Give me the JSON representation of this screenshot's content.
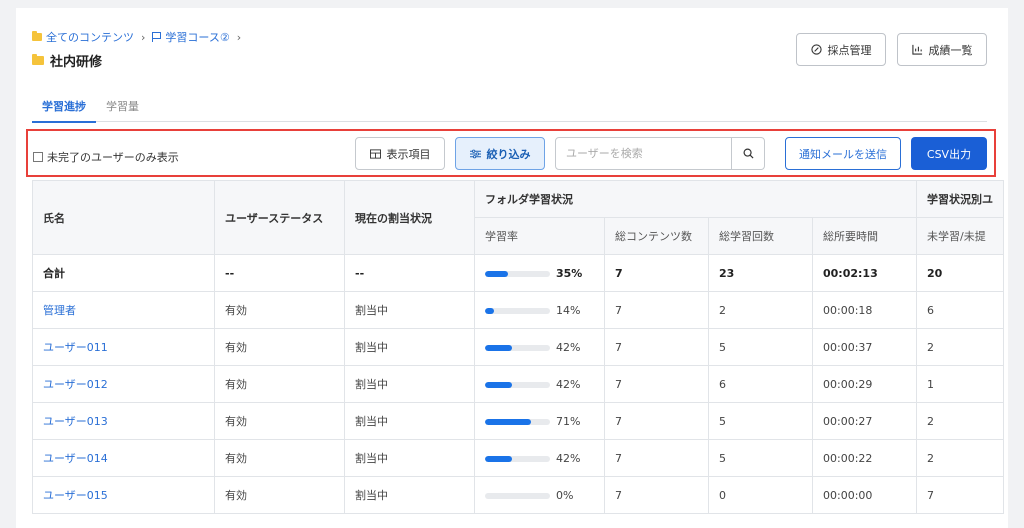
{
  "breadcrumb": {
    "root": "全てのコンテンツ",
    "course": "学習コース②"
  },
  "page_title": "社内研修",
  "header_buttons": {
    "grading": "採点管理",
    "grades": "成績一覧"
  },
  "tabs": [
    {
      "label": "学習進捗",
      "active": true
    },
    {
      "label": "学習量",
      "active": false
    }
  ],
  "toolbar": {
    "incomplete_only": "未完了のユーザーのみ表示",
    "columns_button": "表示項目",
    "filter_button": "絞り込み",
    "search_placeholder": "ユーザーを検索",
    "notify_button": "通知メールを送信",
    "csv_button": "CSV出力"
  },
  "table": {
    "headers": {
      "name": "氏名",
      "user_status": "ユーザーステータス",
      "assignment": "現在の割当状況",
      "folder_group": "フォルダ学習状況",
      "status_group": "学習状況別ユ",
      "rate": "学習率",
      "contents": "総コンテンツ数",
      "count": "総学習回数",
      "time": "総所要時間",
      "not_started": "未学習/未提"
    },
    "rows": [
      {
        "name": "合計",
        "status": "--",
        "assign": "--",
        "rate": 35,
        "rate_label": "35%",
        "contents": "7",
        "count": "23",
        "time": "00:02:13",
        "not_started": "20"
      },
      {
        "name": "管理者",
        "status": "有効",
        "assign": "割当中",
        "rate": 14,
        "rate_label": "14%",
        "contents": "7",
        "count": "2",
        "time": "00:00:18",
        "not_started": "6"
      },
      {
        "name": "ユーザー011",
        "status": "有効",
        "assign": "割当中",
        "rate": 42,
        "rate_label": "42%",
        "contents": "7",
        "count": "5",
        "time": "00:00:37",
        "not_started": "2"
      },
      {
        "name": "ユーザー012",
        "status": "有効",
        "assign": "割当中",
        "rate": 42,
        "rate_label": "42%",
        "contents": "7",
        "count": "6",
        "time": "00:00:29",
        "not_started": "1"
      },
      {
        "name": "ユーザー013",
        "status": "有効",
        "assign": "割当中",
        "rate": 71,
        "rate_label": "71%",
        "contents": "7",
        "count": "5",
        "time": "00:00:27",
        "not_started": "2"
      },
      {
        "name": "ユーザー014",
        "status": "有効",
        "assign": "割当中",
        "rate": 42,
        "rate_label": "42%",
        "contents": "7",
        "count": "5",
        "time": "00:00:22",
        "not_started": "2"
      },
      {
        "name": "ユーザー015",
        "status": "有効",
        "assign": "割当中",
        "rate": 0,
        "rate_label": "0%",
        "contents": "7",
        "count": "0",
        "time": "00:00:00",
        "not_started": "7"
      }
    ]
  },
  "colors": {
    "accent": "#1a73e8",
    "link": "#2a6fd6",
    "highlight_border": "#e8403a",
    "folder": "#f5c33b"
  }
}
